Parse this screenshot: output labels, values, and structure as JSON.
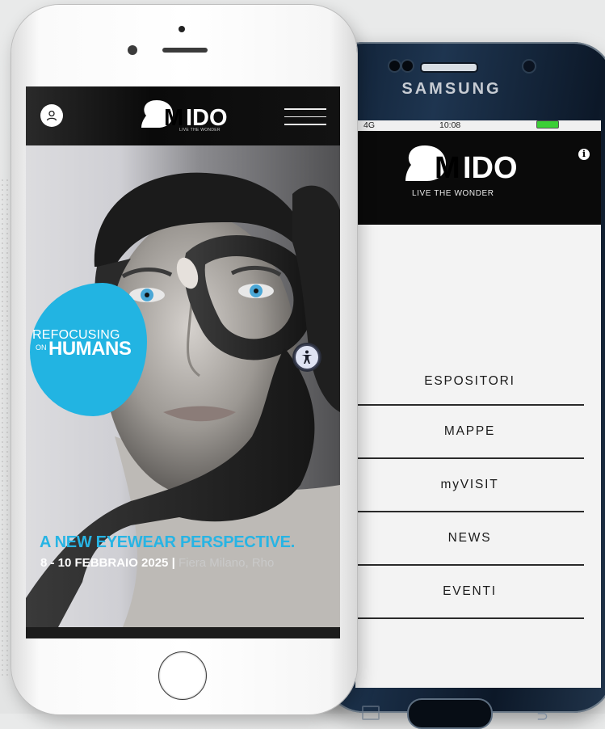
{
  "colors": {
    "mido_blue": "#22b4e2",
    "header_black": "#0a0a0a",
    "battery_green": "#3ccf37",
    "menu_text": "#1b1b1b"
  },
  "samsung": {
    "brand": "SAMSUNG",
    "status": {
      "network": "4G",
      "time": "10:08",
      "battery": "94%"
    },
    "header": {
      "logo": "MIDO",
      "tagline": "LIVE THE WONDER",
      "info_icon": "info-icon"
    },
    "menu": [
      {
        "label": "ESPOSITORI"
      },
      {
        "label": "MAPPE"
      },
      {
        "label": "myVISIT"
      },
      {
        "label": "NEWS"
      },
      {
        "label": "EVENTI"
      }
    ]
  },
  "iphone": {
    "header": {
      "logo": "MIDO",
      "tagline": "LIVE THE WONDER",
      "user_icon": "user-icon",
      "menu_icon": "hamburger-icon"
    },
    "hero": {
      "refocusing": "REFOCUSING",
      "on": "ON",
      "humans": "HUMANS",
      "headline": "A NEW EYEWEAR PERSPECTIVE.",
      "dates": "8 - 10 FEBBRAIO 2025",
      "separator": "|",
      "location": "Fiera Milano, Rho",
      "accessibility_icon": "accessibility-icon"
    }
  }
}
